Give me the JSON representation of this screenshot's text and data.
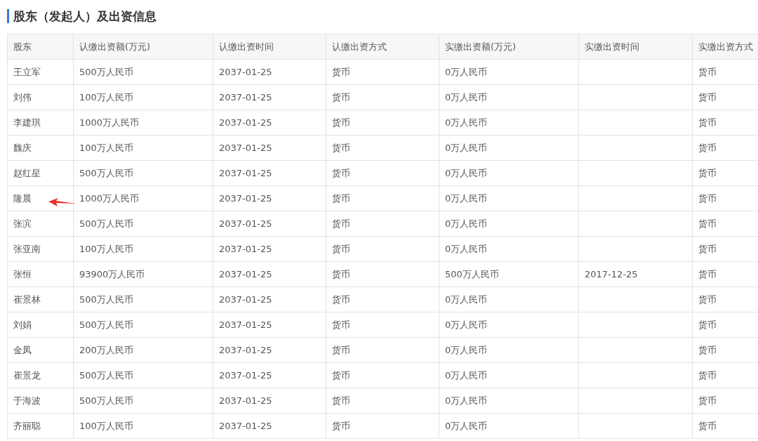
{
  "section_title": "股东（发起人）及出资信息",
  "table": {
    "columns": [
      "股东",
      "认缴出资额(万元)",
      "认缴出资时间",
      "认缴出资方式",
      "实缴出资额(万元)",
      "实缴出资时间",
      "实缴出资方式"
    ],
    "rows": [
      {
        "cells": [
          "王立军",
          "500万人民币",
          "2037-01-25",
          "货币",
          "0万人民币",
          "",
          "货币"
        ],
        "pointed": false
      },
      {
        "cells": [
          "刘伟",
          "100万人民币",
          "2037-01-25",
          "货币",
          "0万人民币",
          "",
          "货币"
        ],
        "pointed": false
      },
      {
        "cells": [
          "李建琪",
          "1000万人民币",
          "2037-01-25",
          "货币",
          "0万人民币",
          "",
          "货币"
        ],
        "pointed": false
      },
      {
        "cells": [
          "魏庆",
          "100万人民币",
          "2037-01-25",
          "货币",
          "0万人民币",
          "",
          "货币"
        ],
        "pointed": false
      },
      {
        "cells": [
          "赵红星",
          "500万人民币",
          "2037-01-25",
          "货币",
          "0万人民币",
          "",
          "货币"
        ],
        "pointed": false
      },
      {
        "cells": [
          "隆晨",
          "1000万人民币",
          "2037-01-25",
          "货币",
          "0万人民币",
          "",
          "货币"
        ],
        "pointed": true
      },
      {
        "cells": [
          "张滨",
          "500万人民币",
          "2037-01-25",
          "货币",
          "0万人民币",
          "",
          "货币"
        ],
        "pointed": false
      },
      {
        "cells": [
          "张亚南",
          "100万人民币",
          "2037-01-25",
          "货币",
          "0万人民币",
          "",
          "货币"
        ],
        "pointed": false
      },
      {
        "cells": [
          "张恒",
          "93900万人民币",
          "2037-01-25",
          "货币",
          "500万人民币",
          "2017-12-25",
          "货币"
        ],
        "pointed": false
      },
      {
        "cells": [
          "崔景林",
          "500万人民币",
          "2037-01-25",
          "货币",
          "0万人民币",
          "",
          "货币"
        ],
        "pointed": false
      },
      {
        "cells": [
          "刘娟",
          "500万人民币",
          "2037-01-25",
          "货币",
          "0万人民币",
          "",
          "货币"
        ],
        "pointed": false
      },
      {
        "cells": [
          "金凤",
          "200万人民币",
          "2037-01-25",
          "货币",
          "0万人民币",
          "",
          "货币"
        ],
        "pointed": false
      },
      {
        "cells": [
          "崔景龙",
          "500万人民币",
          "2037-01-25",
          "货币",
          "0万人民币",
          "",
          "货币"
        ],
        "pointed": false
      },
      {
        "cells": [
          "于海波",
          "500万人民币",
          "2037-01-25",
          "货币",
          "0万人民币",
          "",
          "货币"
        ],
        "pointed": false
      },
      {
        "cells": [
          "齐丽聪",
          "100万人民币",
          "2037-01-25",
          "货币",
          "0万人民币",
          "",
          "货币"
        ],
        "pointed": false
      }
    ]
  }
}
